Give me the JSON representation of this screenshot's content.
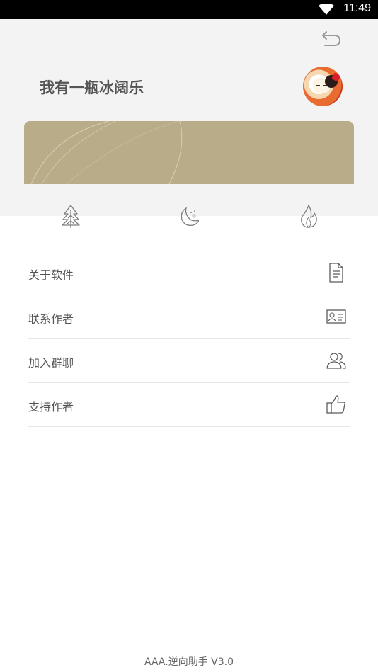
{
  "status_bar": {
    "time": "11:49"
  },
  "header": {
    "username": "我有一瓶冰阔乐"
  },
  "icons": {
    "back": "back-arrow-icon",
    "tree": "tree-icon",
    "moon": "moon-icon",
    "flame": "flame-icon"
  },
  "menu": {
    "items": [
      {
        "label": "关于软件",
        "icon": "document-icon"
      },
      {
        "label": "联系作者",
        "icon": "contact-card-icon"
      },
      {
        "label": "加入群聊",
        "icon": "group-icon"
      },
      {
        "label": "支持作者",
        "icon": "thumbs-up-icon"
      }
    ]
  },
  "footer": {
    "version_text": "AAA.逆向助手 V3.0"
  },
  "colors": {
    "banner": "#b8ad88",
    "header_bg": "#f3f3f3",
    "divider": "#e6e6e6"
  }
}
